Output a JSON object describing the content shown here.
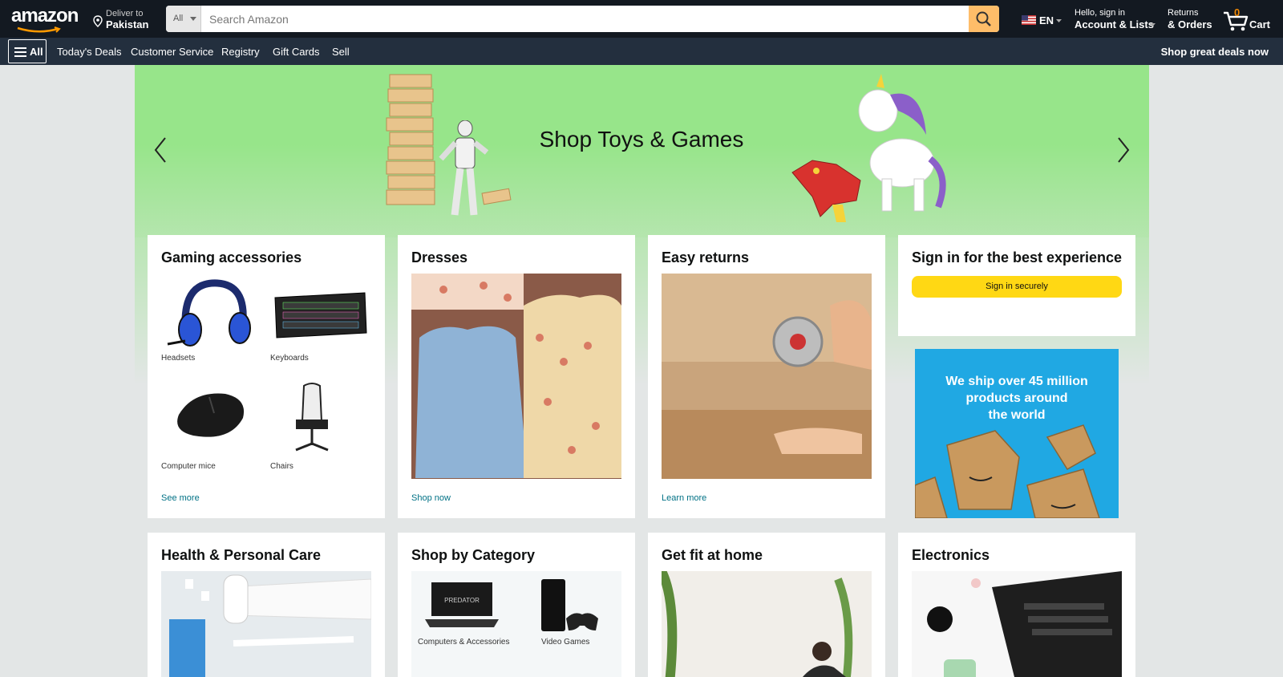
{
  "header": {
    "logo": "amazon",
    "deliver_line1": "Deliver to",
    "deliver_line2": "Pakistan",
    "search_category": "All",
    "search_placeholder": "Search Amazon",
    "language": "EN",
    "account_line1": "Hello, sign in",
    "account_line2": "Account & Lists",
    "returns_line1": "Returns",
    "returns_line2": "& Orders",
    "cart_count": "0",
    "cart_label": "Cart",
    "icons": [
      "location-pin-icon",
      "search-icon",
      "us-flag-icon",
      "cart-icon",
      "menu-icon"
    ]
  },
  "subnav": {
    "all_label": "All",
    "items": [
      "Today's Deals",
      "Customer Service",
      "Registry",
      "Gift Cards",
      "Sell"
    ],
    "promo": "Shop great deals now"
  },
  "hero": {
    "title": "Shop Toys & Games",
    "bg_color": "#97e58a"
  },
  "cards": {
    "gaming": {
      "title": "Gaming accessories",
      "tiles": [
        "Headsets",
        "Keyboards",
        "Computer mice",
        "Chairs"
      ],
      "link": "See more"
    },
    "dresses": {
      "title": "Dresses",
      "link": "Shop now"
    },
    "returns": {
      "title": "Easy returns",
      "link": "Learn more"
    },
    "signin": {
      "title": "Sign in for the best experience",
      "button": "Sign in securely"
    },
    "ship_ad": {
      "line1": "We ship over 45 million",
      "line2": "products around",
      "line3": "the world"
    },
    "health": {
      "title": "Health & Personal Care"
    },
    "category": {
      "title": "Shop by Category",
      "tiles": [
        "Computers & Accessories",
        "Video Games"
      ]
    },
    "fit": {
      "title": "Get fit at home"
    },
    "electronics": {
      "title": "Electronics"
    }
  },
  "colors": {
    "nav": "#131921",
    "subnav": "#232f3e",
    "search_button": "#febd69",
    "signin_button": "#ffd814",
    "link": "#007185",
    "ship_ad": "#20a8e3"
  }
}
